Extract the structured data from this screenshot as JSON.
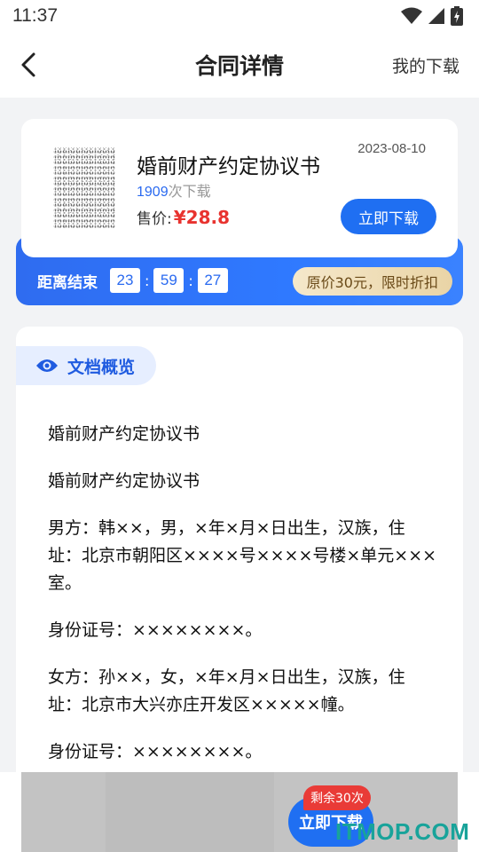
{
  "status_bar": {
    "time": "11:37"
  },
  "nav": {
    "title": "合同详情",
    "right_link": "我的下载",
    "back_icon": "chevron-left-icon"
  },
  "product": {
    "title": "婚前财产约定协议书",
    "date": "2023-08-10",
    "download_count": "1909",
    "download_suffix": "次下载",
    "price_label": "售价:",
    "price": "¥28.8",
    "download_button": "立即下载"
  },
  "promo": {
    "countdown_label": "距离结束",
    "hours": "23",
    "minutes": "59",
    "seconds": "27",
    "separator": ":",
    "discount_text": "原价30元，限时折扣"
  },
  "preview": {
    "tab_label": "文档概览",
    "tab_icon": "eye-icon",
    "paragraphs": [
      "婚前财产约定协议书",
      "婚前财产约定协议书",
      "男方：韩××，男，×年×月×日出生，汉族，住址：北京市朝阳区××××号××××号楼×单元×××室。",
      "身份证号：××××××××。",
      "女方：孙××，女，×年×月×日出生，汉族，住址：北京市大兴亦庄开发区×××××幢。",
      "身份证号：××××××××。"
    ]
  },
  "bottom": {
    "download_button": "立即下载",
    "remaining_badge": "剩余30次"
  },
  "watermark": "ITMOP.COM",
  "colors": {
    "accent": "#1f6ff2",
    "price": "#e8332f",
    "badge": "#e93b37",
    "watermark": "#18a39a"
  }
}
